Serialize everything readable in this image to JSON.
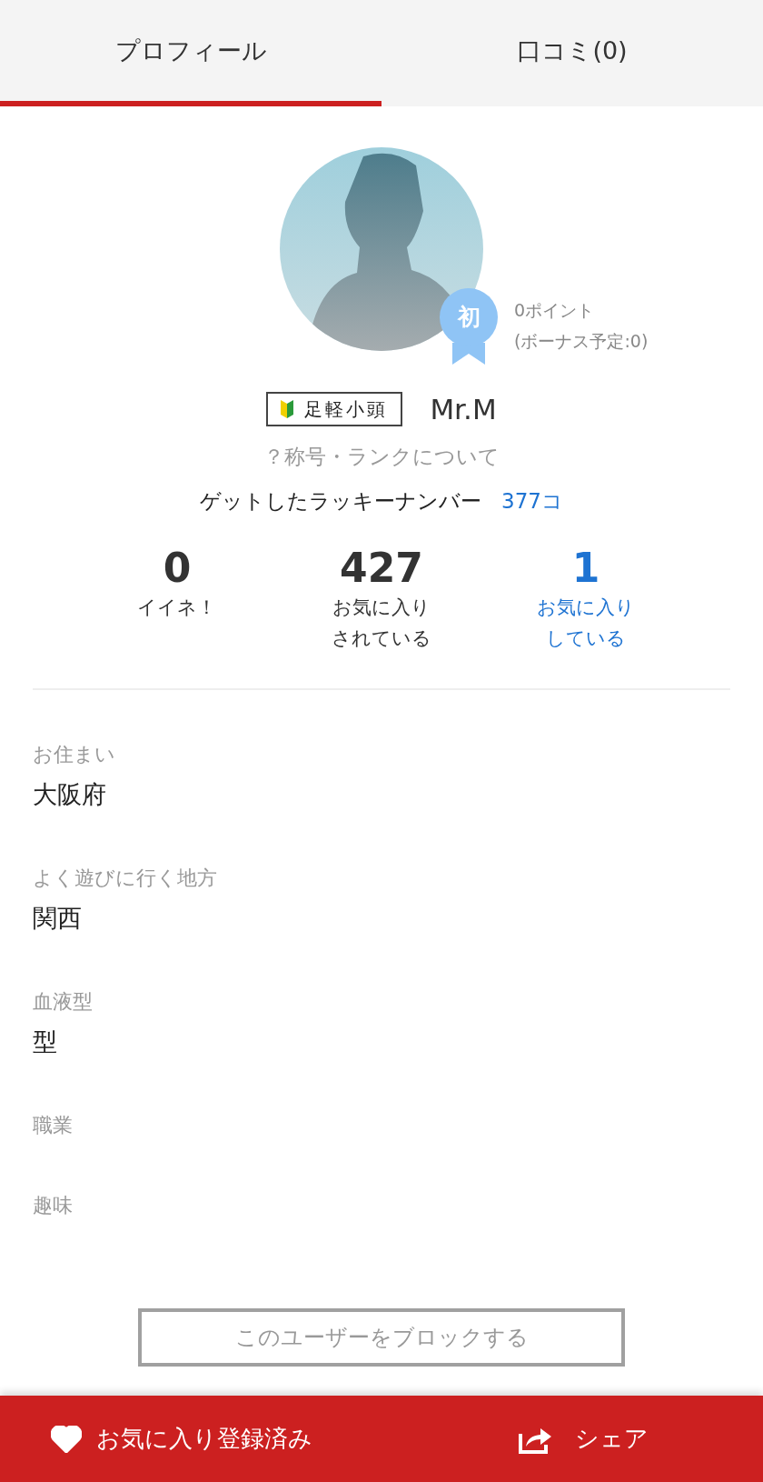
{
  "tabs": [
    {
      "label": "プロフィール",
      "selected": true
    },
    {
      "label": "口コミ(0)",
      "selected": false
    }
  ],
  "profile": {
    "rank_badge": "初",
    "points": "0ポイント",
    "bonus": "(ボーナス予定:0)",
    "title_badge": "足軽小頭",
    "name": "Mr.M",
    "rank_link": "？称号・ランクについて",
    "lucky_label": "ゲットしたラッキーナンバー",
    "lucky_count": "377コ"
  },
  "stats": [
    {
      "value": "0",
      "label": "イイネ！",
      "kind": "plain"
    },
    {
      "value": "427",
      "label": "お気に入りされている",
      "kind": "plain"
    },
    {
      "value": "1",
      "label": "お気に入りしている",
      "kind": "link"
    }
  ],
  "fields": [
    {
      "label": "お住まい",
      "value": "大阪府"
    },
    {
      "label": "よく遊びに行く地方",
      "value": "関西"
    },
    {
      "label": "血液型",
      "value": "型"
    },
    {
      "label": "職業"
    },
    {
      "label": "趣味"
    }
  ],
  "block_button": "このユーザーをブロックする",
  "bottom_bar": {
    "favorite": {
      "label": "お気に入り登録済み",
      "on": true
    },
    "share": "シェア"
  }
}
